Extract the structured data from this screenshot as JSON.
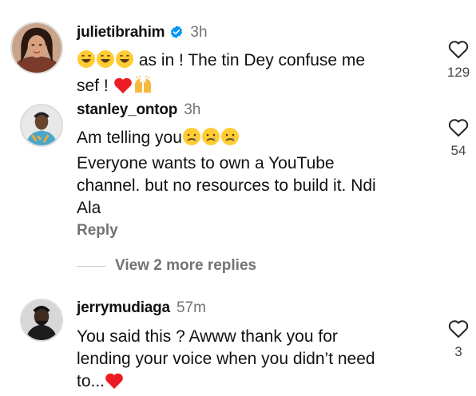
{
  "comments": [
    {
      "username": "julietibrahim",
      "verified": true,
      "time": "3h",
      "lines": [
        "as in ! The tin Dey confuse me",
        "sef !"
      ],
      "likes": "129"
    },
    {
      "username": "stanley_ontop",
      "verified": false,
      "time": "3h",
      "lines": [
        "Am telling you",
        "Everyone wants to own a YouTube",
        "channel. but no resources to build it. Ndi",
        "Ala"
      ],
      "likes": "54",
      "reply_label": "Reply",
      "more_replies": "View 2 more replies"
    },
    {
      "username": "jerrymudiaga",
      "verified": false,
      "time": "57m",
      "lines": [
        "You said this ? Awww thank you for",
        "lending your voice when you didn’t need",
        "to..."
      ],
      "likes": "3"
    }
  ],
  "icons": [
    "verified-badge-icon",
    "heart-outline-icon",
    "grinning-sweat-emoji",
    "red-heart-emoji",
    "raised-hands-emoji",
    "crying-face-emoji"
  ],
  "colors": {
    "verified_blue": "#0095f6",
    "heart_red": "#ed1c24",
    "muted_text": "#737373"
  }
}
